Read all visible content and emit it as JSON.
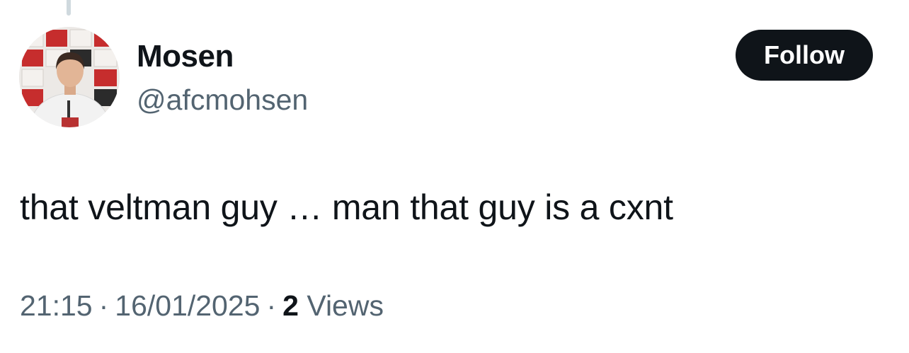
{
  "tweet": {
    "author": {
      "display_name": "Mosen",
      "handle": "@afcmohsen",
      "avatar_icon": "profile-photo"
    },
    "follow_label": "Follow",
    "text": "that veltman guy … man that guy is a cxnt",
    "time": "21:15",
    "date": "16/01/2025",
    "separator": "·",
    "views_count": "2",
    "views_label": "Views"
  },
  "colors": {
    "text_primary": "#0f1419",
    "text_secondary": "#536471",
    "button_bg": "#0f1419",
    "button_text": "#ffffff",
    "thread_line": "#cfd9de"
  }
}
